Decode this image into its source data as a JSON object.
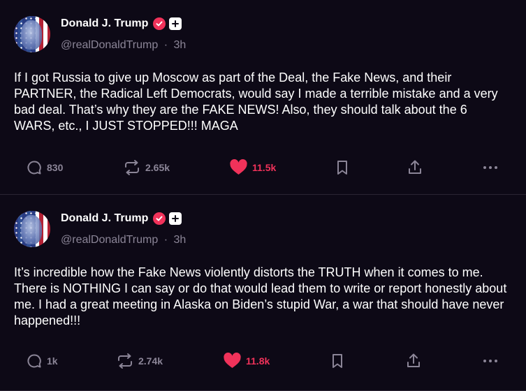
{
  "colors": {
    "background": "#0d0916",
    "divider": "#2a2433",
    "text": "#ffffff",
    "muted": "#8b8597",
    "accent_like": "#f0325a",
    "verified_badge": "#f0325a"
  },
  "posts": [
    {
      "author_name": "Donald J. Trump",
      "handle": "@realDonaldTrump",
      "separator": "·",
      "time": "3h",
      "text": "If I got Russia to give up Moscow as part of the Deal, the Fake News, and their PARTNER, the Radical Left Democrats, would say I made a terrible mistake and a very bad deal. That’s why they are the FAKE NEWS! Also, they should talk about the 6 WARS, etc., I JUST STOPPED!!! MAGA",
      "replies": "830",
      "reposts": "2.65k",
      "likes": "11.5k",
      "liked": true,
      "icons": [
        "reply-icon",
        "repost-icon",
        "heart-icon",
        "bookmark-icon",
        "share-icon",
        "more-icon"
      ]
    },
    {
      "author_name": "Donald J. Trump",
      "handle": "@realDonaldTrump",
      "separator": "·",
      "time": "3h",
      "text": "It’s incredible how the Fake News violently distorts the TRUTH when it comes to me. There is NOTHING I can say or do that would lead them to write or report honestly about me. I had a great meeting in Alaska on Biden’s stupid War, a war that should have never happened!!!",
      "replies": "1k",
      "reposts": "2.74k",
      "likes": "11.8k",
      "liked": true,
      "icons": [
        "reply-icon",
        "repost-icon",
        "heart-icon",
        "bookmark-icon",
        "share-icon",
        "more-icon"
      ]
    }
  ]
}
